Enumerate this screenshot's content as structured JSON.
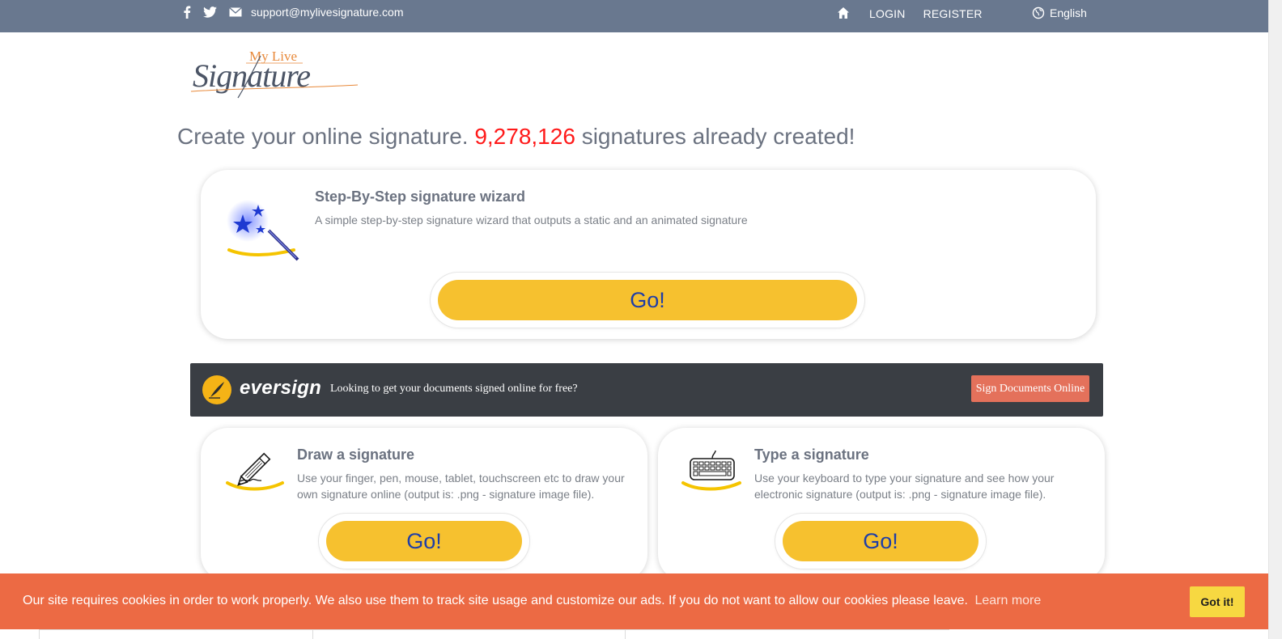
{
  "topbar": {
    "facebook_icon": "facebook-icon",
    "twitter_icon": "twitter-icon",
    "email_icon": "envelope-icon",
    "email": "support@mylivesignature.com",
    "home_icon": "home-icon",
    "login": "LOGIN",
    "register": "REGISTER",
    "language": "English",
    "bg_color": "#69788f"
  },
  "logo": {
    "line1": "My Live",
    "line2": "Signature"
  },
  "headline": {
    "prefix": "Create your online signature.",
    "count": "9,278,126",
    "suffix": "signatures already created!"
  },
  "wizard_card": {
    "title": "Step-By-Step signature wizard",
    "description": "A simple step-by-step signature wizard that outputs a static and an animated signature",
    "button": "Go!",
    "icon": "magic-wand-icon"
  },
  "eversign": {
    "brand": "eversign",
    "message": "Looking to get your documents signed online for free?",
    "button": "Sign Documents Online",
    "bg_color": "#3a3e44",
    "button_color": "#e4715b"
  },
  "draw_card": {
    "title": "Draw a signature",
    "description": "Use your finger, pen, mouse, tablet, touchscreen etc to draw your own signature online (output is: .png - signature image file).",
    "button": "Go!",
    "icon": "pencil-icon"
  },
  "type_card": {
    "title": "Type a signature",
    "description": "Use your keyboard to type your signature and see how your electronic signature (output is: .png - signature image file).",
    "button": "Go!",
    "icon": "keyboard-icon"
  },
  "cookie": {
    "text": "Our site requires cookies in order to work properly. We also use them to track site usage and customize our ads. If you do not want to allow our cookies please leave.",
    "learn_more": "Learn more",
    "button": "Got it!",
    "bg_color": "#ec6a44",
    "button_color": "#f7d841"
  },
  "colors": {
    "accent_yellow": "#f6c12f",
    "go_text": "#1f3ea8",
    "count_red": "#ff1a1a"
  }
}
